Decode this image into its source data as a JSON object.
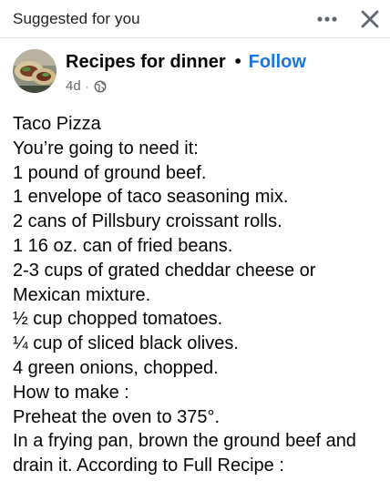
{
  "topbar": {
    "suggested_label": "Suggested for you",
    "more_icon": "more-horizontal-icon",
    "close_icon": "close-icon"
  },
  "post": {
    "page_name": "Recipes for dinner",
    "separator": "•",
    "follow_label": "Follow",
    "time": "4d",
    "audience_icon": "globe-icon",
    "lines": [
      "Taco Pizza",
      "You’re going to need it:",
      "1 pound of ground beef.",
      "1 envelope of taco seasoning mix.",
      "2 cans of Pillsbury croissant rolls.",
      "1 16 oz. can of fried beans.",
      "2-3 cups of grated cheddar cheese or",
      "Mexican mixture.",
      "½ cup chopped tomatoes.",
      "¼ cup of sliced black olives.",
      "4 green onions, chopped.",
      "How to make :",
      "Preheat the oven to 375°.",
      "In a frying pan, brown the ground beef and",
      "drain it. According to Full Recipe :"
    ]
  },
  "colors": {
    "link_blue": "#1b74e4",
    "meta_gray": "#65676b",
    "text": "#050505"
  }
}
